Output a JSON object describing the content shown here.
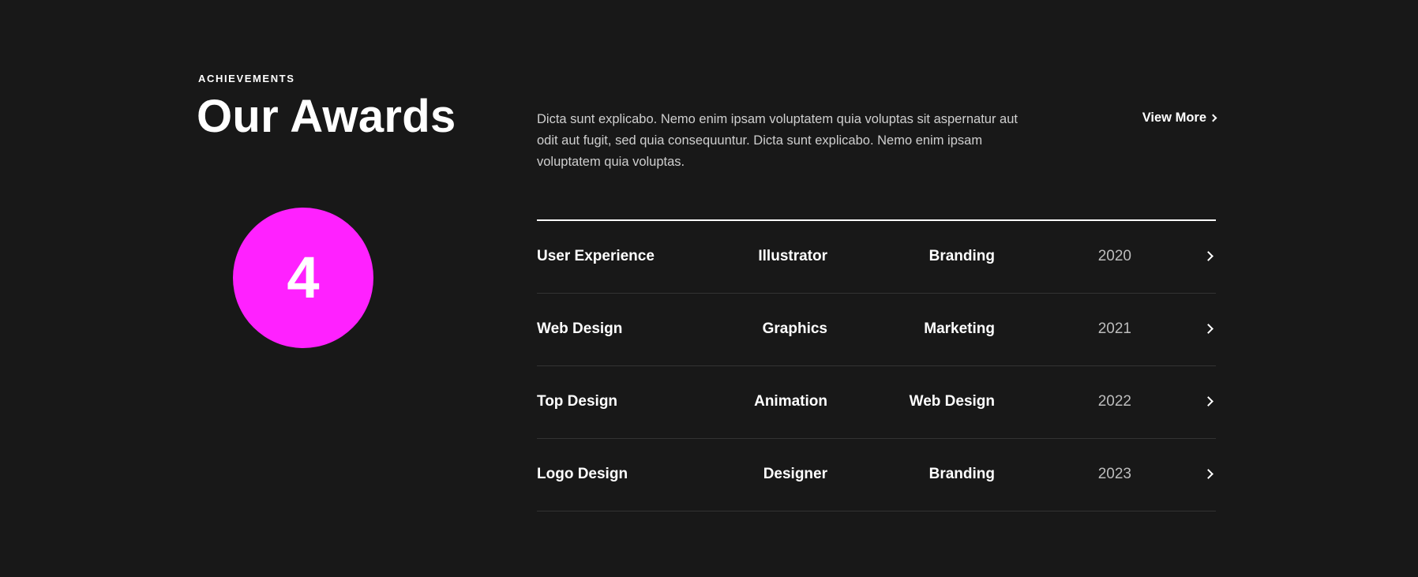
{
  "header": {
    "eyebrow": "ACHIEVEMENTS",
    "title": "Our Awards"
  },
  "counter": {
    "value": "4",
    "color": "#ff21ff"
  },
  "intro": {
    "description": "Dicta sunt explicabo. Nemo enim ipsam voluptatem quia voluptas sit aspernatur aut odit aut fugit, sed quia consequuntur. Dicta sunt explicabo. Nemo enim ipsam voluptatem quia voluptas.",
    "view_more_label": "View More",
    "view_more_icon": "chevron-right-icon"
  },
  "awards": [
    {
      "name": "User Experience",
      "category": "Illustrator",
      "type": "Branding",
      "year": "2020",
      "icon": "chevron-right-icon"
    },
    {
      "name": "Web Design",
      "category": "Graphics",
      "type": "Marketing",
      "year": "2021",
      "icon": "chevron-right-icon"
    },
    {
      "name": "Top Design",
      "category": "Animation",
      "type": "Web Design",
      "year": "2022",
      "icon": "chevron-right-icon"
    },
    {
      "name": "Logo Design",
      "category": "Designer",
      "type": "Branding",
      "year": "2023",
      "icon": "chevron-right-icon"
    }
  ],
  "colors": {
    "background": "#181818",
    "accent": "#ff21ff",
    "text": "#ffffff",
    "muted_text": "#cfcfcf",
    "year_text": "#bdbdbd",
    "divider": "#333333"
  }
}
